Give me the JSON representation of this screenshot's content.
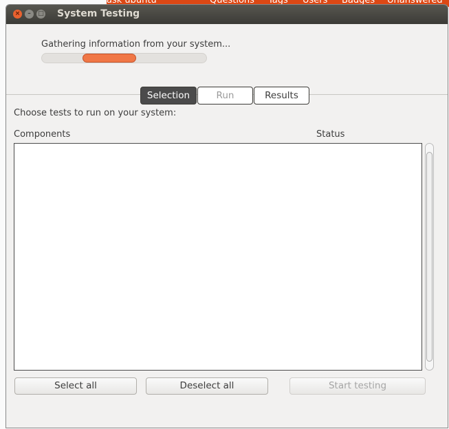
{
  "background": {
    "brand": "ask ubuntu",
    "nav": [
      "Questions",
      "Tags",
      "Users",
      "Badges",
      "Unanswered"
    ]
  },
  "window": {
    "title": "System Testing"
  },
  "progress": {
    "label": "Gathering information from your system...",
    "state": "pulsing",
    "accent": "#f07746"
  },
  "tabs": [
    {
      "label": "Selection",
      "active": true
    },
    {
      "label": "Run",
      "enabled": false
    },
    {
      "label": "Results"
    }
  ],
  "main": {
    "prompt": "Choose tests to run on your system:",
    "columns": [
      "Components",
      "Status"
    ]
  },
  "buttons": {
    "select_all": "Select all",
    "deselect_all": "Deselect all",
    "start_testing": "Start testing"
  }
}
